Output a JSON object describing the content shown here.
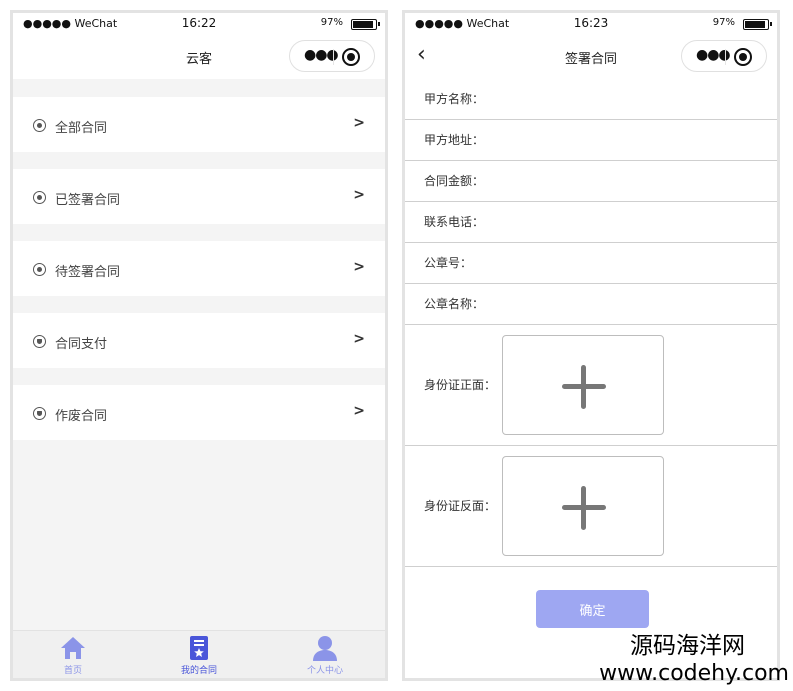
{
  "left": {
    "status": {
      "carrier": "●●●●● WeChat",
      "time": "16:22",
      "battery": "97%"
    },
    "nav": {
      "title": "云客"
    },
    "menu": [
      {
        "label": "全部合同",
        "arrow": ">"
      },
      {
        "label": "已签署合同",
        "arrow": ">"
      },
      {
        "label": "待签署合同",
        "arrow": ">"
      },
      {
        "label": "合同支付",
        "arrow": ">"
      },
      {
        "label": "作废合同",
        "arrow": ">"
      }
    ],
    "tabs": [
      {
        "label": "首页"
      },
      {
        "label": "我的合同"
      },
      {
        "label": "个人中心"
      }
    ]
  },
  "right": {
    "status": {
      "carrier": "●●●●● WeChat",
      "time": "16:23",
      "battery": "97%"
    },
    "nav": {
      "title": "签署合同",
      "back": "‹"
    },
    "fields": [
      {
        "label": "甲方名称："
      },
      {
        "label": "甲方地址："
      },
      {
        "label": "合同金额："
      },
      {
        "label": "联系电话："
      },
      {
        "label": "公章号："
      },
      {
        "label": "公章名称："
      }
    ],
    "photos": [
      {
        "label": "身份证正面："
      },
      {
        "label": "身份证反面："
      }
    ],
    "confirm_label": "确定"
  },
  "watermark": {
    "line1": "源码海洋网",
    "line2": "www.codehy.com"
  },
  "colors": {
    "accent": "#4a56d9",
    "accent_light": "#9ea7f2",
    "tab_inactive": "#8b94e8"
  }
}
